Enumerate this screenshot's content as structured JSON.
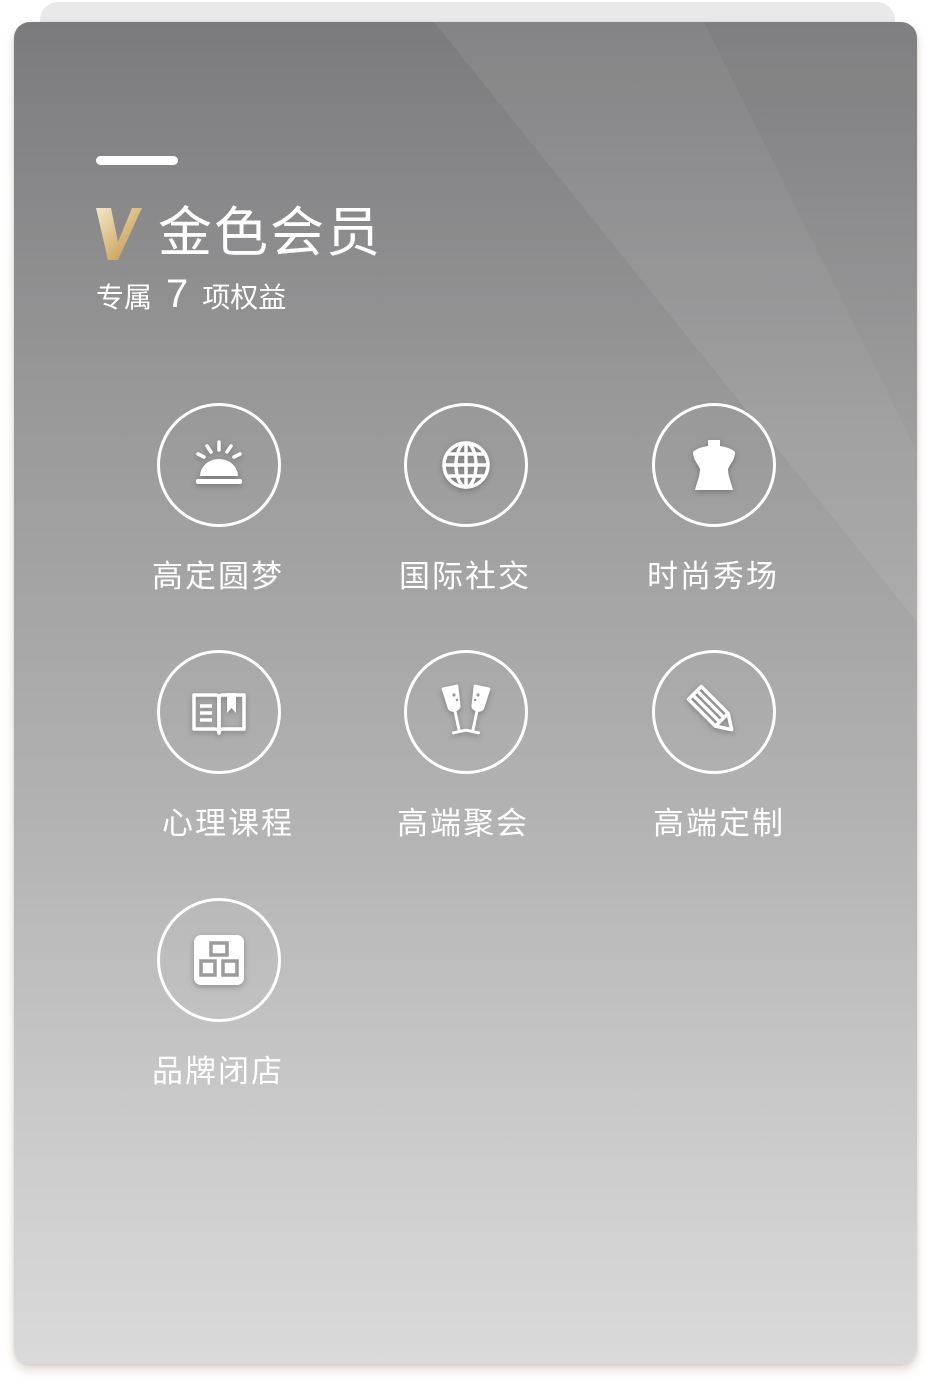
{
  "membership": {
    "title": "金色会员",
    "subtitle_prefix": "专属",
    "benefit_count": "7",
    "subtitle_suffix": "项权益",
    "logo_letter": "V",
    "colors": {
      "gold_light": "#f2e3c2",
      "gold_dark": "#c29a55",
      "card_top": "#7b7b7d",
      "card_bottom": "#dadada"
    }
  },
  "benefits": [
    {
      "label": "高定圆梦",
      "icon": "service-bell-icon"
    },
    {
      "label": "国际社交",
      "icon": "globe-icon"
    },
    {
      "label": "时尚秀场",
      "icon": "mannequin-icon"
    },
    {
      "label": "心理课程",
      "icon": "book-icon"
    },
    {
      "label": "高端聚会",
      "icon": "champagne-glasses-icon"
    },
    {
      "label": "高端定制",
      "icon": "pencil-icon"
    },
    {
      "label": "品牌闭店",
      "icon": "store-icon"
    }
  ]
}
